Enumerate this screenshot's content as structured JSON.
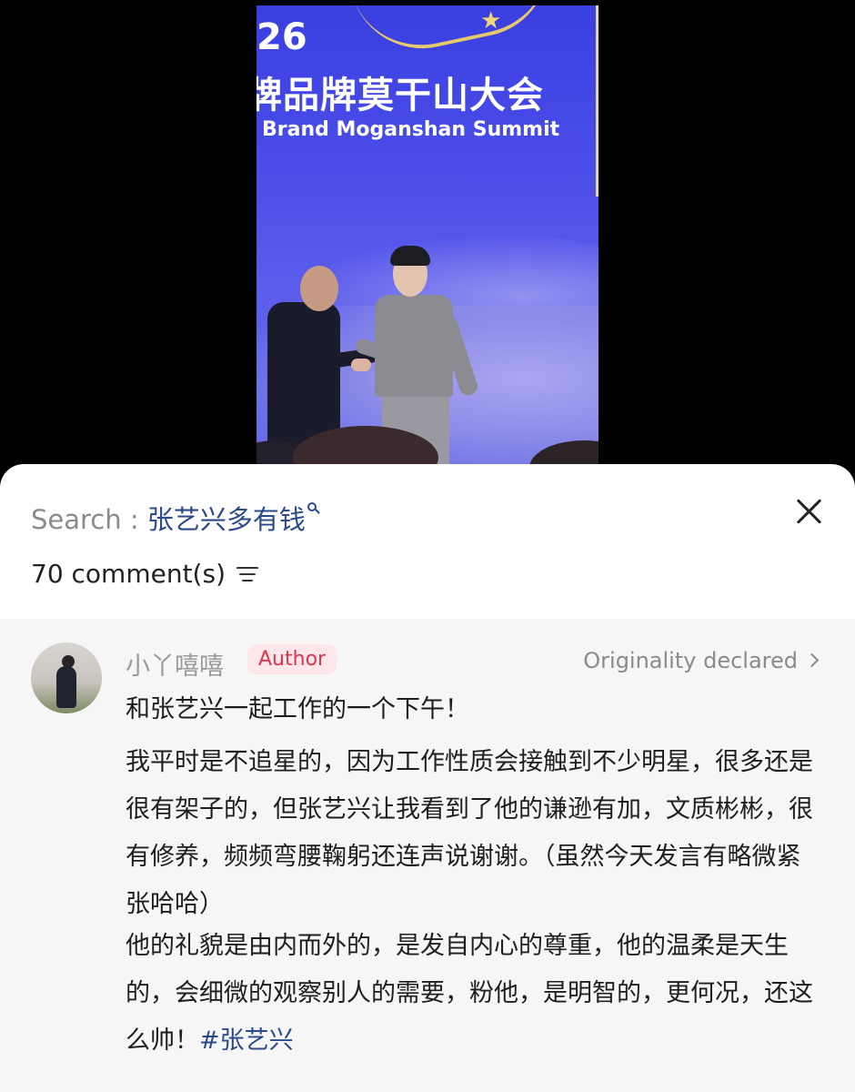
{
  "media": {
    "banner_year": "26",
    "banner_title_cn": "牌品牌莫干山大会",
    "banner_title_en": "Brand Moganshan Summit"
  },
  "sheet": {
    "search_label": "Search :",
    "search_term": "张艺兴多有钱",
    "comment_count": "70 comment(s)"
  },
  "comment": {
    "username": "小丫嘻嘻",
    "author_badge": "Author",
    "originality": "Originality declared",
    "paragraphs": [
      "和张艺兴一起工作的一个下午！",
      "我平时是不追星的，因为工作性质会接触到不少明星，很多还是很有架子的，但张艺兴让我看到了他的谦逊有加，文质彬彬，很有修养，频频弯腰鞠躬还连声说谢谢。（虽然今天发言有略微紧张哈哈）",
      "他的礼貌是由内而外的，是发自内心的尊重，他的温柔是天生的，会细微的观察别人的需要，粉他，是明智的，更何况，还这么帅！"
    ],
    "hashtag": "#张艺兴"
  }
}
